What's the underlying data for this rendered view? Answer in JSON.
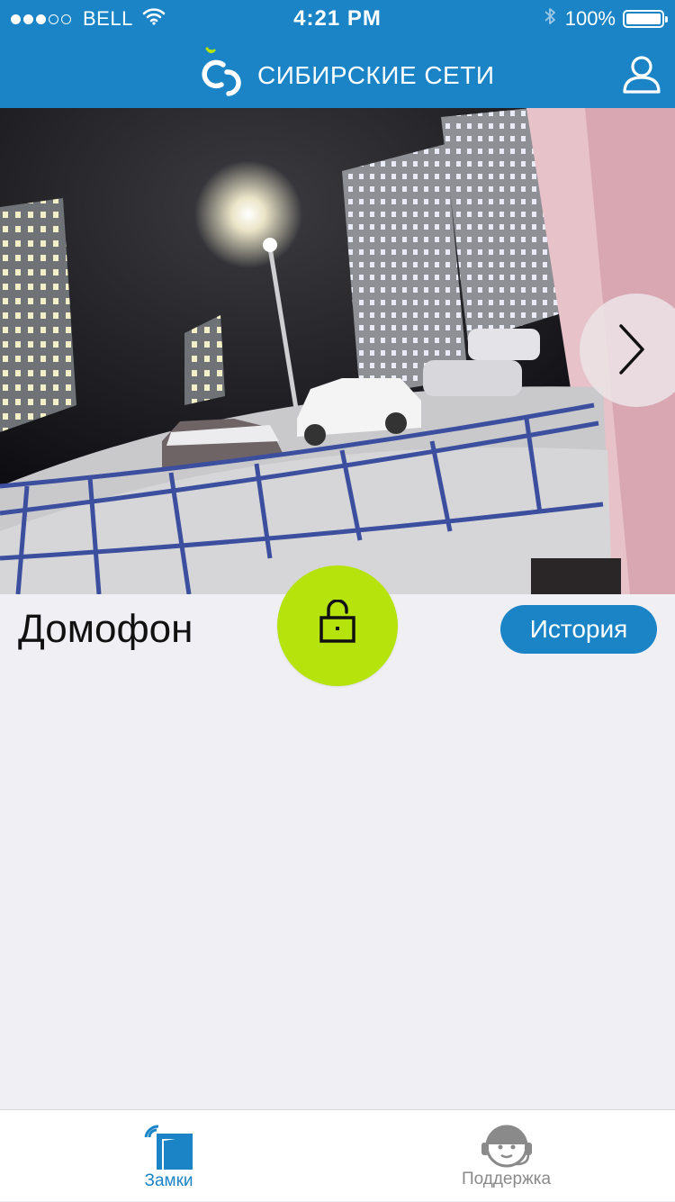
{
  "status_bar": {
    "carrier": "BELL",
    "time": "4:21 PM",
    "battery": "100%",
    "signal_bars_filled": 3,
    "signal_bars_total": 5,
    "icons": [
      "wifi-icon",
      "bluetooth-icon",
      "battery-icon"
    ]
  },
  "app_bar": {
    "brand": "СИБИРСКИЕ СЕТИ",
    "logo_icon": "sibirskie-seti-logo",
    "profile_icon": "user-icon",
    "color": "#1a84c6"
  },
  "camera": {
    "next_icon": "chevron-right-icon"
  },
  "intercom": {
    "title": "Домофон",
    "history_label": "История",
    "unlock_icon": "unlock-icon",
    "unlock_color": "#b6e30c"
  },
  "tabs": [
    {
      "label": "Замки",
      "icon": "door-lock-icon",
      "active": true
    },
    {
      "label": "Поддержка",
      "icon": "support-agent-icon",
      "active": false
    }
  ],
  "colors": {
    "accent": "#1a84c6",
    "action": "#b6e30c",
    "background": "#efeff4"
  }
}
